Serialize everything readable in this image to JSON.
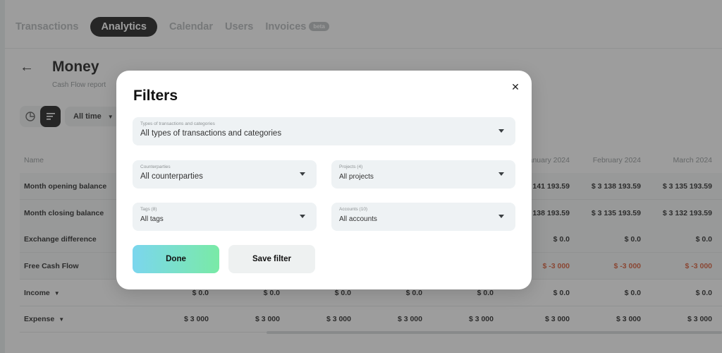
{
  "nav": {
    "tabs": [
      {
        "label": "Transactions"
      },
      {
        "label": "Analytics"
      },
      {
        "label": "Calendar"
      },
      {
        "label": "Users"
      },
      {
        "label": "Invoices"
      }
    ],
    "invoices_badge": "beta"
  },
  "page": {
    "title": "Money",
    "subtitle": "Cash Flow report",
    "period_label": "All time"
  },
  "table": {
    "name_header": "Name",
    "month_headers": [
      "January 2024",
      "February 2024",
      "March 2024"
    ],
    "rows": [
      {
        "name": "Month opening balance",
        "values": [
          "$ 3 141 193.59",
          "$ 3 138 193.59",
          "$ 3 135 193.59"
        ]
      },
      {
        "name": "Month closing balance",
        "values": [
          "$ 3 138 193.59",
          "$ 3 135 193.59",
          "$ 3 132 193.59"
        ]
      },
      {
        "name": "Exchange difference",
        "values": [
          "$ 0.0",
          "$ 0.0",
          "$ 0.0"
        ]
      },
      {
        "name": "Free Cash Flow",
        "values": [
          "$ -3 000",
          "$ -3 000",
          "$ -3 000"
        ]
      },
      {
        "name": "Income",
        "values": [
          "$ 0.0",
          "$ 0.0",
          "$ 0.0",
          "$ 0.0",
          "$ 0.0",
          "$ 0.0",
          "$ 0.0",
          "$ 0.0"
        ]
      },
      {
        "name": "Expense",
        "values": [
          "$ 3 000",
          "$ 3 000",
          "$ 3 000",
          "$ 3 000",
          "$ 3 000",
          "$ 3 000",
          "$ 3 000",
          "$ 3 000"
        ]
      }
    ]
  },
  "modal": {
    "title": "Filters",
    "close_icon": "close-icon",
    "types": {
      "label": "Types of transactions and categories",
      "value": "All types of transactions and categories"
    },
    "counterparties": {
      "label": "Counterparties",
      "value": "All counterparties"
    },
    "projects": {
      "label": "Projects (4)",
      "value": "All projects"
    },
    "tags": {
      "label": "Tags (8)",
      "value": "All tags"
    },
    "accounts": {
      "label": "Accounts (10)",
      "value": "All accounts"
    },
    "done_label": "Done",
    "save_label": "Save filter"
  },
  "colors": {
    "negative": "#d9532c",
    "accent_gradient_start": "#7bd6ee",
    "accent_gradient_end": "#79eaa6"
  }
}
